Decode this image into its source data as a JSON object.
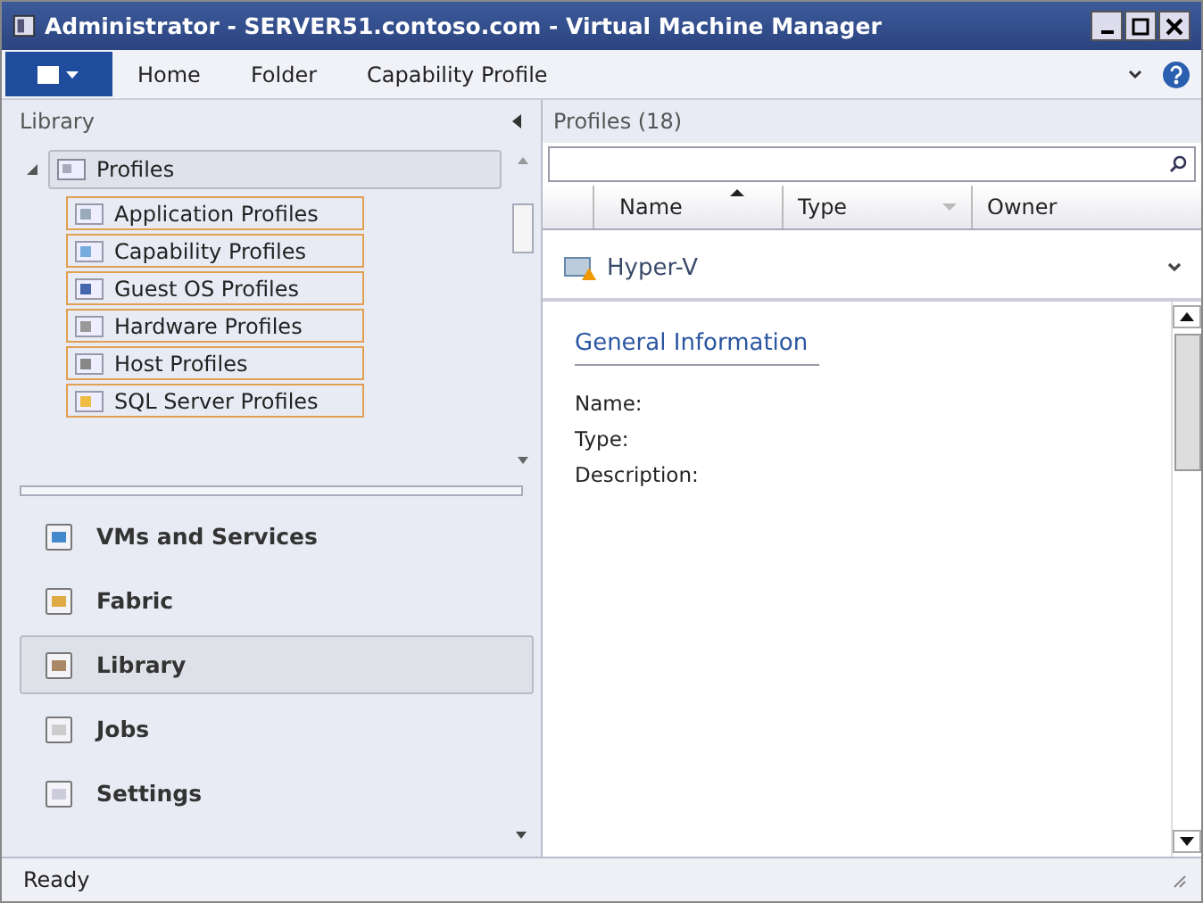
{
  "window": {
    "title": "Administrator - SERVER51.contoso.com - Virtual Machine Manager"
  },
  "ribbon_tabs": [
    {
      "label": "Home"
    },
    {
      "label": "Folder"
    },
    {
      "label": "Capability Profile"
    }
  ],
  "left_pane": {
    "title": "Library",
    "tree": [
      {
        "label": "Profiles",
        "selected": true,
        "expanded": true,
        "children": [
          {
            "label": "Application Profiles",
            "outlined": true
          },
          {
            "label": "Capability Profiles",
            "outlined": true
          },
          {
            "label": "Guest OS Profiles",
            "outlined": true
          },
          {
            "label": "Hardware Profiles",
            "outlined": true
          },
          {
            "label": "Host Profiles",
            "outlined": true
          },
          {
            "label": "SQL Server Profiles",
            "outlined": true
          }
        ]
      }
    ],
    "nav": [
      {
        "label": "VMs and Services",
        "selected": false
      },
      {
        "label": "Fabric",
        "selected": false
      },
      {
        "label": "Library",
        "selected": true
      },
      {
        "label": "Jobs",
        "selected": false
      },
      {
        "label": "Settings",
        "selected": false
      }
    ]
  },
  "right_pane": {
    "title": "Profiles (18)",
    "columns": [
      {
        "label": "Name",
        "sorted": true
      },
      {
        "label": "Type",
        "sorted": false
      },
      {
        "label": "Owner",
        "sorted": false
      }
    ],
    "group": {
      "label": "Hyper-V"
    },
    "details": {
      "heading": "General Information",
      "fields": [
        "Name:",
        "Type:",
        "Description:"
      ]
    }
  },
  "status_bar": "Ready"
}
